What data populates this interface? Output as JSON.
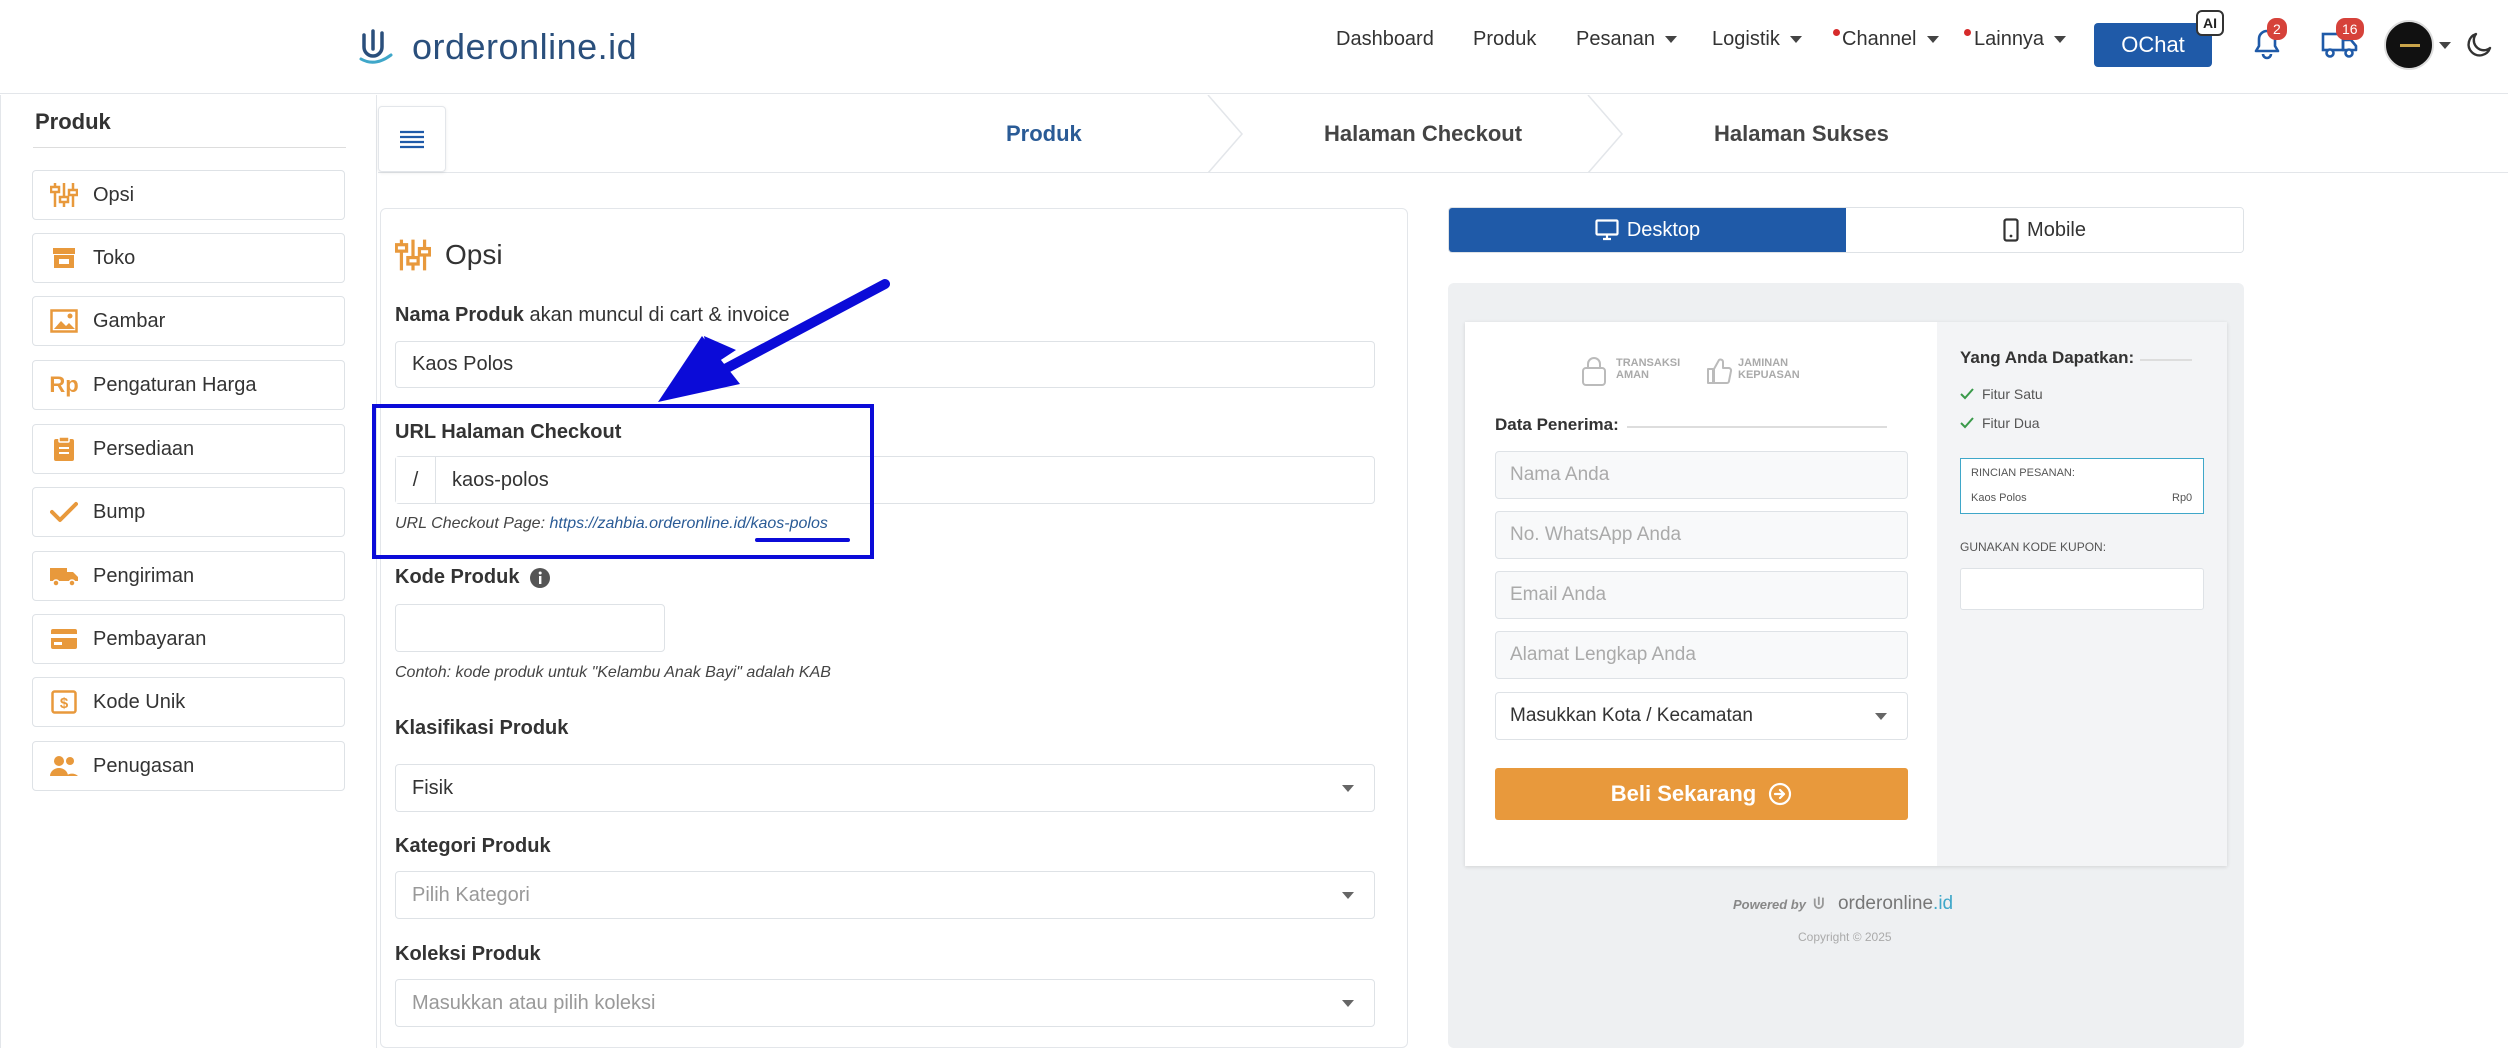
{
  "brand": {
    "name_main": "orderonline",
    "name_ext": ".id"
  },
  "nav": {
    "dashboard": "Dashboard",
    "produk": "Produk",
    "pesanan": "Pesanan",
    "logistik": "Logistik",
    "channel": "Channel",
    "lainnya": "Lainnya",
    "ochat": "OChat",
    "ai_badge": "AI",
    "notif_count": "2",
    "shipping_count": "16"
  },
  "sidebar": {
    "title": "Produk",
    "items": [
      {
        "label": "Opsi",
        "icon": "sliders-icon"
      },
      {
        "label": "Toko",
        "icon": "store-icon"
      },
      {
        "label": "Gambar",
        "icon": "image-icon"
      },
      {
        "label": "Pengaturan Harga",
        "icon": "rp-icon"
      },
      {
        "label": "Persediaan",
        "icon": "clipboard-icon"
      },
      {
        "label": "Bump",
        "icon": "check-icon"
      },
      {
        "label": "Pengiriman",
        "icon": "truck-icon"
      },
      {
        "label": "Pembayaran",
        "icon": "card-icon"
      },
      {
        "label": "Kode Unik",
        "icon": "dollar-box-icon"
      },
      {
        "label": "Penugasan",
        "icon": "users-icon"
      }
    ]
  },
  "stepper": {
    "step1": "Produk",
    "step2": "Halaman Checkout",
    "step3": "Halaman Sukses"
  },
  "form": {
    "title": "Opsi",
    "nama_label": "Nama Produk",
    "nama_note": "akan muncul di cart & invoice",
    "nama_value": "Kaos Polos",
    "url_label": "URL Halaman Checkout",
    "url_prefix": "/",
    "url_value": "kaos-polos",
    "url_hint_prefix": "URL Checkout Page:",
    "url_hint_link": "https://zahbia.orderonline.id/kaos-polos",
    "kode_label": "Kode Produk",
    "kode_value": "",
    "kode_hint": "Contoh: kode produk untuk \"Kelambu Anak Bayi\" adalah KAB",
    "klasifikasi_label": "Klasifikasi Produk",
    "klasifikasi_value": "Fisik",
    "kategori_label": "Kategori Produk",
    "kategori_placeholder": "Pilih Kategori",
    "koleksi_label": "Koleksi Produk",
    "koleksi_placeholder": "Masukkan atau pilih koleksi"
  },
  "preview": {
    "tab_desktop": "Desktop",
    "tab_mobile": "Mobile",
    "trust1": "TRANSAKSI\nAMAN",
    "trust2": "JAMINAN\nKEPUASAN",
    "data_penerima": "Data Penerima:",
    "ph_nama": "Nama Anda",
    "ph_wa": "No. WhatsApp Anda",
    "ph_email": "Email Anda",
    "ph_alamat": "Alamat Lengkap Anda",
    "ph_kota": "Masukkan Kota / Kecamatan",
    "buy_label": "Beli Sekarang",
    "yang_anda": "Yang Anda Dapatkan:",
    "fitur1": "Fitur Satu",
    "fitur2": "Fitur Dua",
    "rincian": "RINCIAN PESANAN:",
    "rincian_item": "Kaos Polos",
    "rincian_price": "Rp0",
    "kupon": "GUNAKAN KODE KUPON:",
    "powered_by": "Powered by",
    "powered_brand": "orderonline",
    "powered_ext": ".id",
    "copyright": "Copyright © 2025"
  }
}
